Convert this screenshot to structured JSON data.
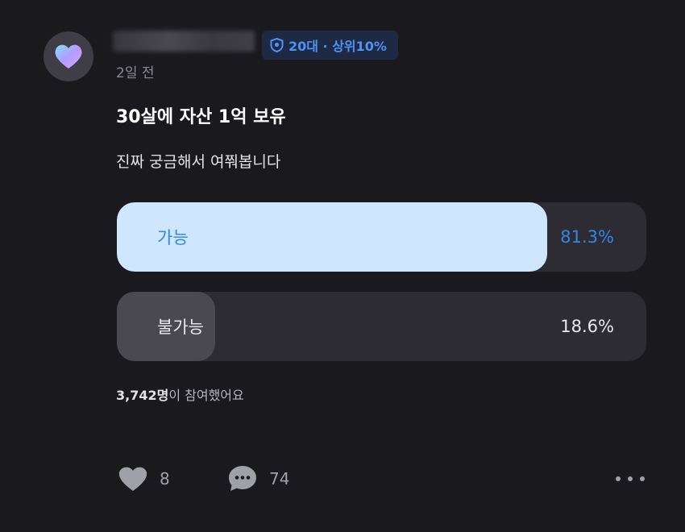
{
  "post": {
    "badge_text": "20대 · 상위10%",
    "time_ago": "2일 전",
    "title": "30살에 자산 1억 보유",
    "body": "진짜 궁금해서 여쭤봅니다"
  },
  "poll": {
    "options": [
      {
        "label": "가능",
        "percent_text": "81.3%",
        "percent": 81.3
      },
      {
        "label": "불가능",
        "percent_text": "18.6%",
        "percent": 18.6
      }
    ],
    "participants_count": "3,742명",
    "participants_suffix": "이 참여했어요"
  },
  "actions": {
    "like_count": "8",
    "comment_count": "74"
  },
  "icons": {
    "avatar": "heart-icon",
    "badge": "shield-icon",
    "like": "heart-icon",
    "comment": "speech-bubble-icon",
    "more": "more-dots-icon"
  },
  "colors": {
    "background": "#1a191e",
    "accent": "#3385e6",
    "selected_fill": "#cfe6ff",
    "badge_bg": "#1e2a44"
  }
}
